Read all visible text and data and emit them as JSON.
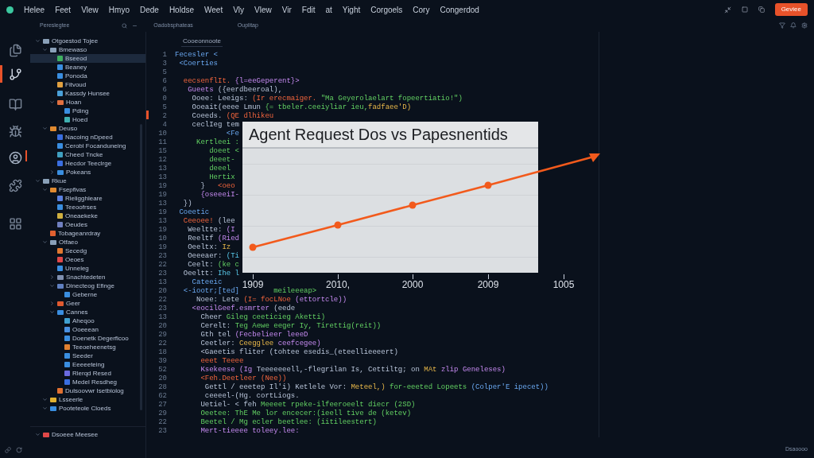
{
  "menu": [
    "Helee",
    "Feet",
    "Vlew",
    "Hmyo",
    "Dede",
    "Holdse",
    "Weet",
    "Vly",
    "Vlew",
    "Vir",
    "Fdit",
    "at",
    "Yight",
    "Corgoels",
    "Cory",
    "Congerdod"
  ],
  "action_button": "Geviee",
  "toolbar": [
    "Pereslegtee",
    "Oadobsphateas",
    "Ouplitap"
  ],
  "activity_bar": [
    {
      "selected": false,
      "alert": false
    },
    {
      "selected": true,
      "alert": false
    },
    {
      "selected": false,
      "alert": false
    },
    {
      "selected": false,
      "alert": false
    },
    {
      "selected": false,
      "alert": true
    },
    {
      "selected": false,
      "alert": false
    },
    {
      "selected": false,
      "alert": false
    }
  ],
  "tree": [
    {
      "label": "Otgoestod Tojee",
      "kind": "folder",
      "expanded": true,
      "selected": false,
      "color": "#8aa0b8",
      "children": [
        {
          "label": "Bmewaso",
          "kind": "folder",
          "expanded": true,
          "selected": false,
          "color": "#8aa0b8",
          "children": [
            {
              "label": "Bseeod",
              "kind": "file",
              "selected": true,
              "color": "#3fb060"
            },
            {
              "label": "Beaney",
              "kind": "file",
              "selected": false,
              "color": "#3a8ee0"
            },
            {
              "label": "Ponoda",
              "kind": "file",
              "selected": false,
              "color": "#3a8ee0"
            },
            {
              "label": "Fitvoud",
              "kind": "file",
              "selected": false,
              "color": "#e0a040"
            },
            {
              "label": "Kassdy Hunsee",
              "kind": "file",
              "selected": false,
              "color": "#4aa0d8"
            },
            {
              "label": "Hoan",
              "kind": "folder",
              "expanded": true,
              "selected": false,
              "color": "#e07040",
              "children": [
                {
                  "label": "Pding",
                  "kind": "file",
                  "selected": false,
                  "color": "#3a8ee0"
                },
                {
                  "label": "Hoed",
                  "kind": "file",
                  "selected": false,
                  "color": "#40b0b0"
                }
              ]
            }
          ]
        },
        {
          "label": "Deuso",
          "kind": "folder",
          "expanded": true,
          "selected": false,
          "color": "#e08a30",
          "children": [
            {
              "label": "Nacoing nDpeed",
              "kind": "file",
              "selected": false,
              "color": "#3a6ee0"
            },
            {
              "label": "Cerobl Focanduneing",
              "kind": "file",
              "selected": false,
              "color": "#3a8ee0"
            },
            {
              "label": "Cheed Tncke",
              "kind": "file",
              "selected": false,
              "color": "#40a0c0"
            },
            {
              "label": "Hecdor Teeclrge",
              "kind": "file",
              "selected": false,
              "color": "#3a6ee0"
            },
            {
              "label": "Pokeans",
              "kind": "folder",
              "expanded": false,
              "selected": false,
              "color": "#3a8ee0"
            }
          ]
        }
      ]
    },
    {
      "label": "Rkue",
      "kind": "folder",
      "expanded": true,
      "selected": false,
      "color": "#8aa0b8",
      "children": [
        {
          "label": "Fsepfivas",
          "kind": "folder",
          "expanded": true,
          "selected": false,
          "color": "#e08a30",
          "children": [
            {
              "label": "Rieligghleare",
              "kind": "file",
              "selected": false,
              "color": "#5a80e0"
            },
            {
              "label": "Teeoofrses",
              "kind": "file",
              "selected": false,
              "color": "#3a8ee0"
            },
            {
              "label": "Oneaekeke",
              "kind": "file",
              "selected": false,
              "color": "#d0b040"
            },
            {
              "label": "Oeudes",
              "kind": "file",
              "selected": false,
              "color": "#7080c0"
            }
          ]
        },
        {
          "label": "Tobageanrdray",
          "kind": "file",
          "selected": false,
          "color": "#e06030"
        },
        {
          "label": "Otfaeo",
          "kind": "folder",
          "expanded": true,
          "selected": false,
          "color": "#8aa0b8",
          "children": [
            {
              "label": "Secedg",
              "kind": "file",
              "selected": false,
              "color": "#e07830"
            },
            {
              "label": "Oeoes",
              "kind": "file",
              "selected": false,
              "color": "#e04848"
            },
            {
              "label": "Unneleg",
              "kind": "file",
              "selected": false,
              "color": "#3a8ee0"
            },
            {
              "label": "Snachtedeten",
              "kind": "folder",
              "expanded": false,
              "selected": false,
              "color": "#8090b0"
            },
            {
              "label": "Dinecteog Efinge",
              "kind": "folder",
              "expanded": true,
              "selected": false,
              "color": "#6080c0",
              "children": [
                {
                  "label": "Geberne",
                  "kind": "file",
                  "selected": false,
                  "color": "#3a8ee0"
                }
              ]
            },
            {
              "label": "Geer",
              "kind": "folder",
              "expanded": false,
              "selected": false,
              "color": "#e05a30"
            },
            {
              "label": "Cannes",
              "kind": "folder",
              "expanded": true,
              "selected": false,
              "color": "#3a8ee0",
              "children": [
                {
                  "label": "Aheqoo",
                  "kind": "file",
                  "selected": false,
                  "color": "#40a0d0"
                },
                {
                  "label": "Ooeeean",
                  "kind": "file",
                  "selected": false,
                  "color": "#4a90e0"
                },
                {
                  "label": "Doenetk Degerficoo",
                  "kind": "file",
                  "selected": false,
                  "color": "#3a8ee0"
                },
                {
                  "label": "Teeoeheenetsg",
                  "kind": "file",
                  "selected": false,
                  "color": "#e08030"
                },
                {
                  "label": "Seeder",
                  "kind": "file",
                  "selected": false,
                  "color": "#3a8ee0"
                },
                {
                  "label": "Eeeeeteing",
                  "kind": "file",
                  "selected": false,
                  "color": "#3a8ee0"
                },
                {
                  "label": "Rlerqd Resed",
                  "kind": "file",
                  "selected": false,
                  "color": "#6a6ae0"
                },
                {
                  "label": "Medel Resdheg",
                  "kind": "file",
                  "selected": false,
                  "color": "#3a6ee0"
                }
              ]
            },
            {
              "label": "Dulsoovwr Isetbiolog",
              "kind": "file",
              "selected": false,
              "color": "#e07030"
            }
          ]
        },
        {
          "label": "Lsseerle",
          "kind": "folder",
          "expanded": true,
          "selected": false,
          "color": "#e0b030"
        },
        {
          "label": "Pooteteole Cloeds",
          "kind": "folder",
          "expanded": true,
          "selected": false,
          "color": "#3a8ee0"
        }
      ]
    }
  ],
  "tree_footer": {
    "label": "Dsoeee Meesee",
    "kind": "folder",
    "expanded": true,
    "selected": false,
    "color": "#e04848"
  },
  "editor_tab": "Cooeonnoote",
  "code": [
    {
      "num": "1",
      "segs": [
        {
          "t": "Fecesler <",
          "kind": "tag"
        }
      ]
    },
    {
      "num": "3",
      "segs": [
        {
          "t": " <Coerties",
          "kind": "tag"
        }
      ]
    },
    {
      "num": "5"
    },
    {
      "num": "6",
      "segs": [
        {
          "t": "  eecsenflIt.",
          "kind": "keyword"
        },
        {
          "t": " {l=eeGeperent}>",
          "kind": "attr"
        }
      ]
    },
    {
      "num": "6",
      "segs": [
        {
          "t": "   Gueets ",
          "kind": "attr"
        },
        {
          "t": "({eerdbeeroal),",
          "kind": "plain"
        }
      ]
    },
    {
      "num": "0",
      "segs": [
        {
          "t": "    Ooee: Leeigs: ",
          "kind": "plain"
        },
        {
          "t": "(Ir erecmaiger. ",
          "kind": "keyword"
        },
        {
          "t": "\"Ma Geyerolaelart fopeertiatio!\")",
          "kind": "string"
        }
      ]
    },
    {
      "num": "5",
      "segs": [
        {
          "t": "    Ooeait(eeee Lmun ",
          "kind": "plain"
        },
        {
          "t": "{= tbeler.ceeiyliar ieu,",
          "kind": "string"
        },
        {
          "t": "fadfaee'D)",
          "kind": "number"
        }
      ]
    },
    {
      "num": "2",
      "breakpoint": true,
      "segs": [
        {
          "t": "    Coeeds. ",
          "kind": "plain"
        },
        {
          "t": "(QE dlhikeu",
          "kind": "keyword"
        }
      ]
    },
    {
      "num": "4",
      "segs": [
        {
          "t": "    ceclIeg tem",
          "kind": "plain"
        }
      ]
    },
    {
      "num": "10",
      "segs": [
        {
          "t": "            <Fe",
          "kind": "tag"
        }
      ]
    },
    {
      "num": "11",
      "segs": [
        {
          "t": "     Kertleei :",
          "kind": "string"
        }
      ]
    },
    {
      "num": "15",
      "segs": [
        {
          "t": "        doeet <",
          "kind": "string"
        }
      ]
    },
    {
      "num": "12",
      "segs": [
        {
          "t": "        deeet-",
          "kind": "string"
        }
      ]
    },
    {
      "num": "13",
      "segs": [
        {
          "t": "        deeel",
          "kind": "string"
        }
      ]
    },
    {
      "num": "13",
      "segs": [
        {
          "t": "        Hertix",
          "kind": "string"
        }
      ]
    },
    {
      "num": "19",
      "segs": [
        {
          "t": "      }   ",
          "kind": "plain"
        },
        {
          "t": "<oeo",
          "kind": "keyword"
        }
      ]
    },
    {
      "num": "19",
      "segs": [
        {
          "t": "      {oseeeiI-",
          "kind": "attr"
        }
      ]
    },
    {
      "num": "13",
      "segs": [
        {
          "t": "  })",
          "kind": "plain"
        }
      ]
    },
    {
      "num": "19",
      "segs": [
        {
          "t": " Coeetic",
          "kind": "tag"
        }
      ]
    },
    {
      "num": "13",
      "segs": [
        {
          "t": "  Ceeoee! ",
          "kind": "keyword"
        },
        {
          "t": "(lee",
          "kind": "plain"
        }
      ]
    },
    {
      "num": "19",
      "segs": [
        {
          "t": "   Weeltte: ",
          "kind": "plain"
        },
        {
          "t": "(I",
          "kind": "attr"
        }
      ]
    },
    {
      "num": "10",
      "segs": [
        {
          "t": "   Reeltf ",
          "kind": "plain"
        },
        {
          "t": "(Ried",
          "kind": "attr"
        }
      ]
    },
    {
      "num": "19",
      "segs": [
        {
          "t": "   Oeeltx:",
          "kind": "plain"
        },
        {
          "t": " Iz",
          "kind": "number"
        }
      ]
    },
    {
      "num": "23",
      "segs": [
        {
          "t": "   Oeeeaer:",
          "kind": "plain"
        },
        {
          "t": " (Ti",
          "kind": "type"
        }
      ]
    },
    {
      "num": "22",
      "segs": [
        {
          "t": "   Ceelt: ",
          "kind": "plain"
        },
        {
          "t": "(ke c",
          "kind": "string"
        }
      ]
    },
    {
      "num": "23",
      "segs": [
        {
          "t": "  Oeeltt: ",
          "kind": "plain"
        },
        {
          "t": "Ihe l",
          "kind": "type"
        }
      ]
    },
    {
      "num": "13",
      "segs": [
        {
          "t": "    Cateeic",
          "kind": "tag"
        }
      ]
    },
    {
      "num": "20",
      "segs": [
        {
          "t": "  <-iootr;[ted]",
          "kind": "tag"
        },
        {
          "t": "        meileeeap>",
          "kind": "string"
        }
      ]
    },
    {
      "num": "22",
      "segs": [
        {
          "t": "     Noee: Lete ",
          "kind": "plain"
        },
        {
          "t": "(I= focLNoe ",
          "kind": "keyword"
        },
        {
          "t": "(ettortcle))",
          "kind": "attr"
        }
      ]
    },
    {
      "num": "23",
      "segs": [
        {
          "t": "    <eocilGeef.esmrter ",
          "kind": "attr"
        },
        {
          "t": "(eede",
          "kind": "plain"
        }
      ]
    },
    {
      "num": "13",
      "segs": [
        {
          "t": "      Cheer ",
          "kind": "plain"
        },
        {
          "t": "Gileg ceeticieg Aketti)",
          "kind": "string"
        }
      ]
    },
    {
      "num": "20",
      "segs": [
        {
          "t": "      Cerelt: ",
          "kind": "plain"
        },
        {
          "t": "Teg Aewe eeger Iy, Tirettig(reit))",
          "kind": "string"
        }
      ]
    },
    {
      "num": "29",
      "segs": [
        {
          "t": "      Gth tel ",
          "kind": "plain"
        },
        {
          "t": "(Fecbelieer leeeD",
          "kind": "attr"
        }
      ]
    },
    {
      "num": "22",
      "segs": [
        {
          "t": "      Ceetler: ",
          "kind": "plain"
        },
        {
          "t": "Ceegglee ",
          "kind": "number"
        },
        {
          "t": "ceefcegee)",
          "kind": "attr"
        }
      ]
    },
    {
      "num": "18",
      "segs": [
        {
          "t": "      <Gaeetis fliter ",
          "kind": "plain"
        },
        {
          "t": "(tohtee esedis_(eteellieeeert)",
          "kind": "plain"
        }
      ]
    },
    {
      "num": "39",
      "segs": [
        {
          "t": "      eeet Teeee",
          "kind": "keyword"
        }
      ]
    },
    {
      "num": "52",
      "segs": [
        {
          "t": "      Ksekeese (Ig ",
          "kind": "attr"
        },
        {
          "t": "Teeeeeeell,-flegrilan Is, Cettiltg; on ",
          "kind": "plain"
        },
        {
          "t": "MAt ",
          "kind": "number"
        },
        {
          "t": "zlip Geneleses)",
          "kind": "attr"
        }
      ]
    },
    {
      "num": "20",
      "segs": [
        {
          "t": "      <Feh.Deetleer (Nee))",
          "kind": "keyword"
        }
      ]
    },
    {
      "num": "28",
      "segs": [
        {
          "t": "       Gettl / eeetep Il'i) Ketlele Vor: ",
          "kind": "plain"
        },
        {
          "t": "Meteel,) ",
          "kind": "number"
        },
        {
          "t": "for-eeeted Lopeets ",
          "kind": "string"
        },
        {
          "t": "(Colper'E ipecet))",
          "kind": "tag"
        }
      ]
    },
    {
      "num": "62",
      "segs": [
        {
          "t": "       ceeeel-(Hg. cortLiogs.",
          "kind": "plain"
        }
      ]
    },
    {
      "num": "27",
      "segs": [
        {
          "t": "      Uetiel- < feh ",
          "kind": "plain"
        },
        {
          "t": "Meeeet rpeke-ilfeeroeelt diecr (2SD)",
          "kind": "string"
        }
      ]
    },
    {
      "num": "29",
      "segs": [
        {
          "t": "      Oeetee: ThE Me lor encecer:(ieell tive de (ketev)",
          "kind": "string"
        }
      ]
    },
    {
      "num": "22",
      "segs": [
        {
          "t": "      Beetel / Mg ecler beetlee: (iitileestert)",
          "kind": "string"
        }
      ]
    },
    {
      "num": "23",
      "segs": [
        {
          "t": "      Mert-tieeee toleey.lee:",
          "kind": "attr"
        }
      ]
    }
  ],
  "chart": {
    "title": "Agent Request Dos vs Papesnentids",
    "x_labels": [
      "1909",
      "2010,",
      "2000",
      "2009",
      "1005"
    ]
  },
  "status": "Dsaoooo"
}
